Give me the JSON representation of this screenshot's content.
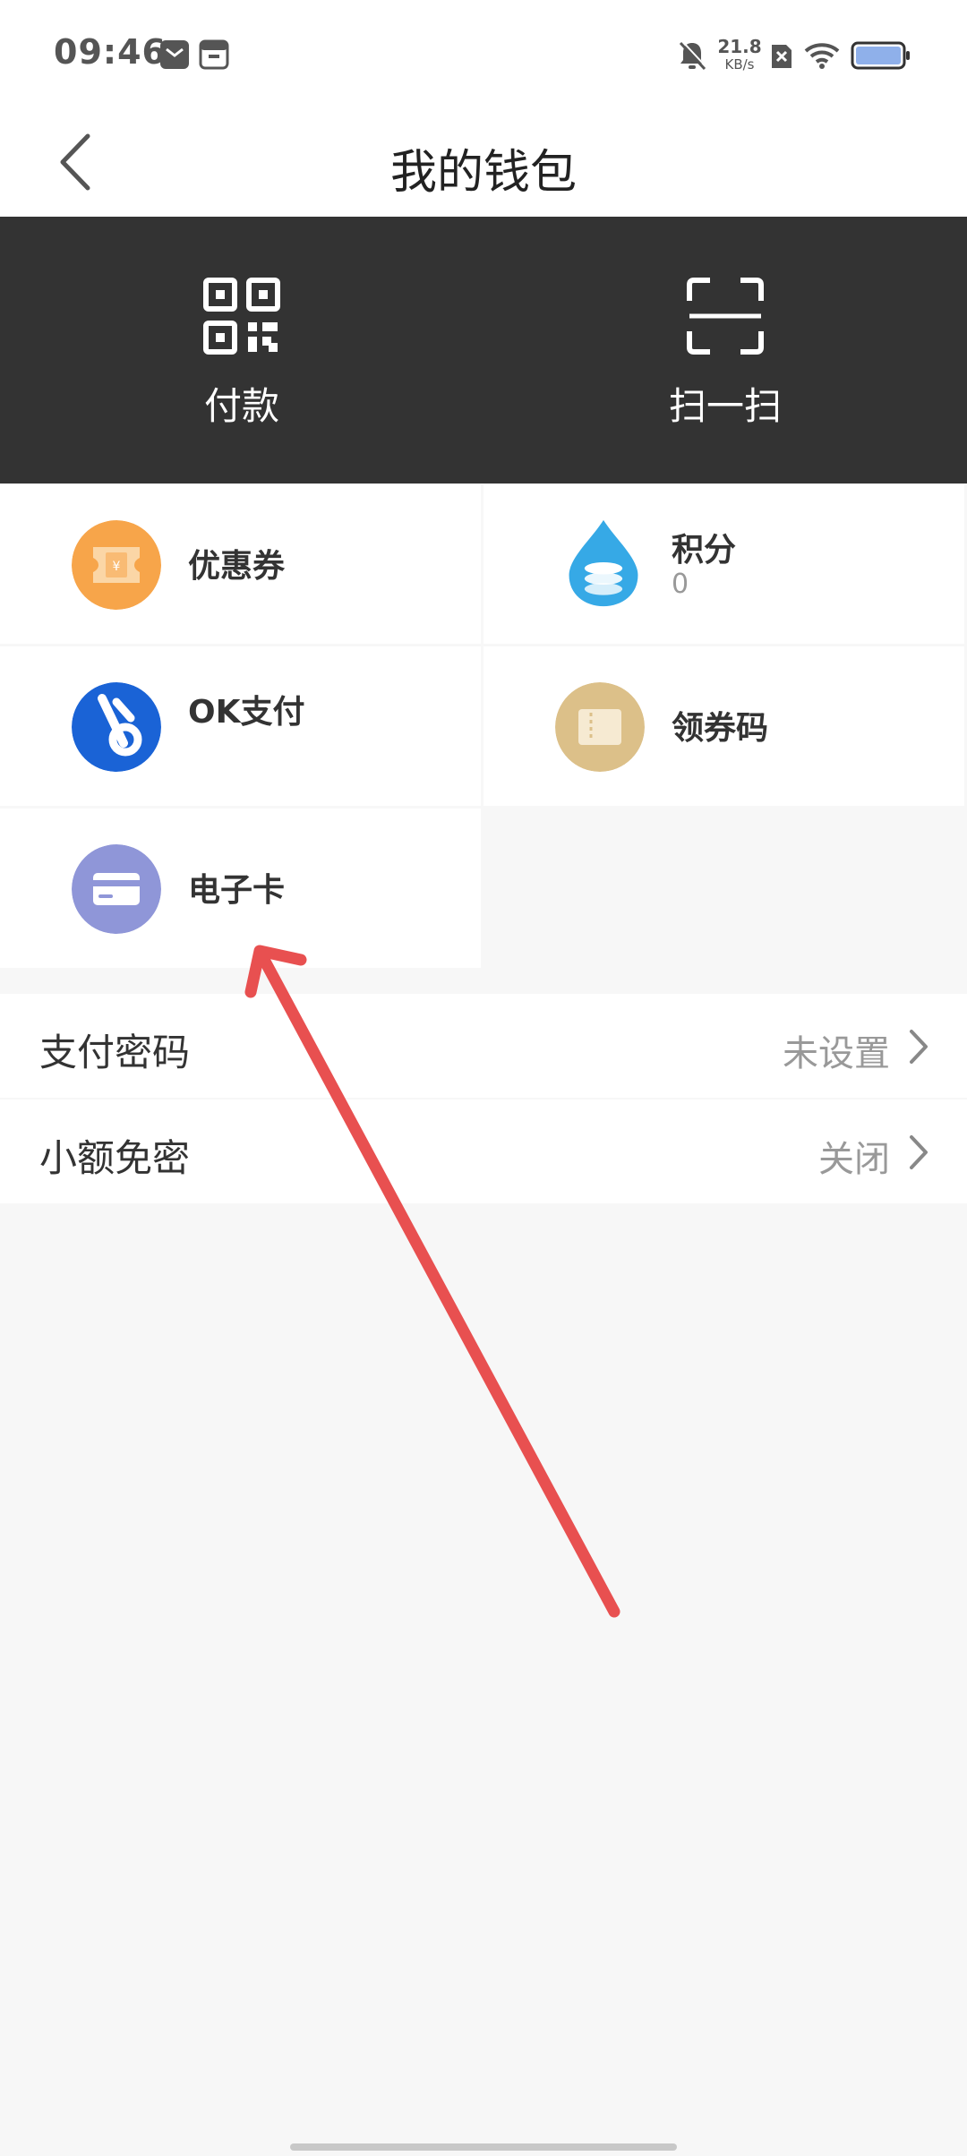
{
  "status_bar": {
    "time": "09:46",
    "speed_value": "21.8",
    "speed_unit": "KB/s"
  },
  "header": {
    "title": "我的钱包",
    "back_icon": "chevron-left-icon"
  },
  "actions": [
    {
      "label": "付款",
      "icon": "qr-code-icon"
    },
    {
      "label": "扫一扫",
      "icon": "scan-icon"
    }
  ],
  "grid": {
    "coupon": {
      "label": "优惠券",
      "color": "#f7a54a"
    },
    "points": {
      "label": "积分",
      "value": "0",
      "color": "#36a9e6"
    },
    "okpay": {
      "label": "OK支付",
      "color": "#1a63d6"
    },
    "coupon_code": {
      "label": "领券码",
      "color": "#dcc089"
    },
    "ecard": {
      "label": "电子卡",
      "color": "#8f96d8"
    }
  },
  "list": {
    "pay_password": {
      "label": "支付密码",
      "value": "未设置"
    },
    "small_free": {
      "label": "小额免密",
      "value": "关闭"
    }
  },
  "annotation_color": "#e85050"
}
